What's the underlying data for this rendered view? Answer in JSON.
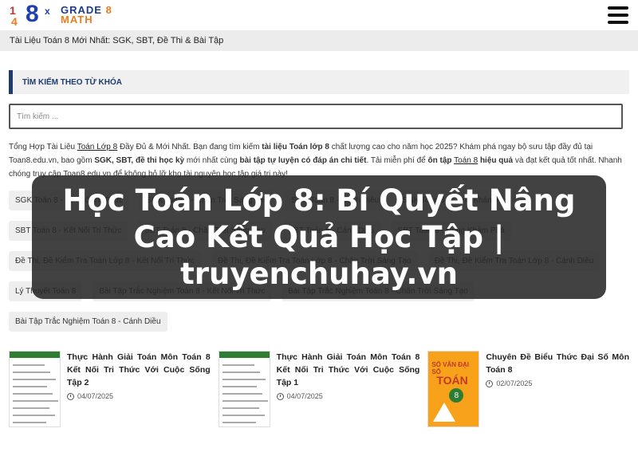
{
  "logo": {
    "mark": [
      "1",
      "8",
      "4",
      "x"
    ],
    "line1": "GRADE",
    "line1_num": "8",
    "line2": "MATH"
  },
  "topbar": {
    "title": "Tài Liệu Toán 8 Mới Nhất: SGK, SBT, Đề Thi & Bài Tập"
  },
  "search": {
    "section_title": "TÌM KIẾM THEO TỪ KHÓA",
    "placeholder": "Tìm kiếm ..."
  },
  "intro": {
    "p1": "Tổng Hợp Tài Liệu ",
    "link1": "Toán Lớp 8",
    "p2": " Đầy Đủ & Mới Nhất. Bạn đang tìm kiếm ",
    "b1": "tài liệu Toán lớp 8",
    "p3": " chất lượng cao cho năm học 2025? Khám phá ngay bộ sưu tập đầy đủ tại Toan8.edu.vn, bao gồm ",
    "b2": "SGK, SBT, đề thi học kỳ",
    "p4": " mới nhất cùng ",
    "b3": "bài tập tự luyện có đáp án chi tiết",
    "p5": ". Tải miễn phí để ",
    "b4": "ôn tập",
    "p6": " ",
    "link2": "Toán 8",
    "b5": " hiệu quả",
    "p7": " và đạt kết quả tốt nhất. Nhanh chóng truy cập Toan8.edu.vn để không bỏ lỡ kho tài nguyên học tập giá trị này!"
  },
  "tags": [
    "SGK Toán 8 - Kết Nối Tri Thức",
    "SGK Toán 8 - Chân Trời Sáng Tạo",
    "SGK Toán 8 - Cánh Diều",
    "SGK Toán 8 - Cùng Khám Phá",
    "SBT Toán 8 - Kết Nối Tri Thức",
    "SBT Toán 8 - Chân Trời Sáng Tạo",
    "SBT Toán 8 - Cánh Diều",
    "SBT Toán 8 - Cùng Khám Phá",
    "Đề Thi, Đề Kiểm Tra Toán Lớp 8 - Kết Nối Tri Thức",
    "Đề Thi, Đề Kiểm Tra Toán Lớp 8 - Chân Trời Sáng Tạo",
    "Đề Thi, Đề Kiểm Tra Toán Lớp 8 - Cánh Diều",
    "Lý Thuyết Toán 8",
    "Bài Tập Trắc Nghiệm Toán 8 - Kết Nối Tri Thức",
    "Bài Tập Trắc Nghiệm Toán 8 - Chân Trời Sáng Tạo",
    "Bài Tập Trắc Nghiệm Toán 8 - Cánh Diều"
  ],
  "cards": [
    {
      "title": "Thực Hành Giải Toán Môn Toán 8 Kết Nối Tri Thức Với Cuộc Sống Tập 2",
      "date": "04/07/2025",
      "thumb": "worksheet"
    },
    {
      "title": "Thực Hành Giải Toán Môn Toán 8 Kết Nối Tri Thức Với Cuộc Sống Tập 1",
      "date": "04/07/2025",
      "thumb": "worksheet"
    },
    {
      "title": "Chuyên Đề Biểu Thức Đại Số Môn Toán 8",
      "date": "02/07/2025",
      "thumb": "book"
    }
  ],
  "book_cover": {
    "title": "SỔ VĂN ĐẠI SỐ",
    "big": "TOÁN",
    "badge": "8"
  },
  "overlay": {
    "text": "Học Toán Lớp 8: Bí Quyết Nâng Cao Kết Quả Học Tập | truyenchuhay.vn"
  }
}
